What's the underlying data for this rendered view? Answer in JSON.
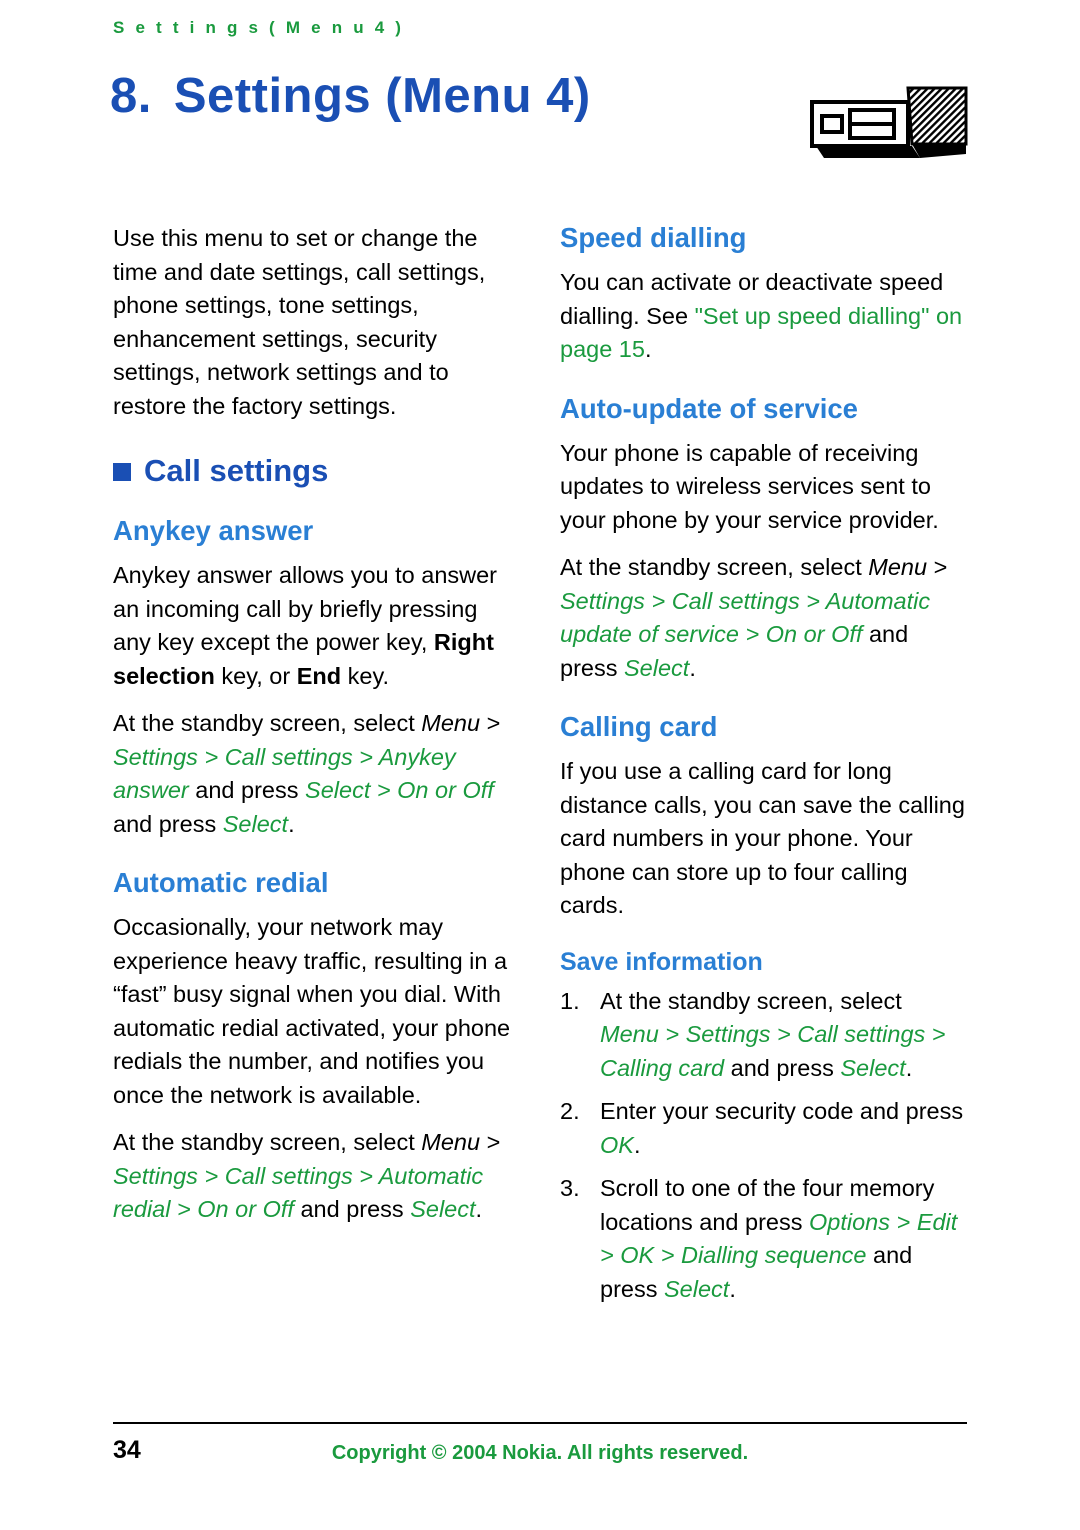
{
  "header": {
    "running_head": "S e t t i n g s   ( M e n u   4 )"
  },
  "title": {
    "number": "8.",
    "text": "Settings (Menu 4)",
    "icon": "screwdriver-tools-icon"
  },
  "left_column": {
    "intro": "Use this menu to set or change the time and date settings, call settings, phone settings, tone settings, enhancement settings, security settings, network settings and to restore the factory settings.",
    "call_settings_heading": "Call settings",
    "anykey_heading": "Anykey answer",
    "anykey_body_1": "Anykey answer allows you to answer an incoming call by briefly pressing any key except the power key, ",
    "anykey_body_bold_1": "Right selection",
    "anykey_body_2": " key, or ",
    "anykey_body_bold_2": "End",
    "anykey_body_3": " key.",
    "anykey_path_1": "At the standby screen, select ",
    "anykey_path_menu": "Menu",
    "anykey_path_2": " > ",
    "anykey_path_green": "Settings > Call settings > Anykey answer",
    "anykey_path_3": " and press ",
    "anykey_path_select1": "Select",
    "anykey_path_4": " > ",
    "anykey_path_on": "On",
    "anykey_path_5": " or ",
    "anykey_path_off": "Off",
    "anykey_path_6": " and press ",
    "anykey_path_select2": "Select",
    "anykey_path_7": ".",
    "autoredial_heading": "Automatic redial",
    "autoredial_body": "Occasionally, your network may experience heavy traffic, resulting in a “fast” busy signal when you dial. With automatic redial activated, your phone redials the number, and notifies you once the network is available.",
    "autoredial_path_1": "At the standby screen, select ",
    "autoredial_path_menu": "Menu",
    "autoredial_path_2": " > ",
    "autoredial_path_green": "Settings > Call settings > Automatic redial",
    "autoredial_path_3": " > ",
    "autoredial_path_on": "On",
    "autoredial_path_4": " or ",
    "autoredial_path_off": "Off",
    "autoredial_path_5": " and press ",
    "autoredial_path_select": "Select",
    "autoredial_path_6": "."
  },
  "right_column": {
    "speed_heading": "Speed dialling",
    "speed_body_1": "You can activate or deactivate speed dialling. See ",
    "speed_body_green1": "\"Set up speed dialling\" on page",
    "speed_body_2": " 15",
    "speed_body_3": ".",
    "autoupdate_heading": "Auto-update of service",
    "autoupdate_body": "Your phone is capable of receiving updates to wireless services sent to your phone by your service provider.",
    "autoupdate_path_1": "At the standby screen, select ",
    "autoupdate_path_menu": "Menu",
    "autoupdate_path_2": " > ",
    "autoupdate_path_green": "Settings > Call settings > Automatic update of service",
    "autoupdate_path_3": " > ",
    "autoupdate_path_on": "On",
    "autoupdate_path_4": " or ",
    "autoupdate_path_off": "Off",
    "autoupdate_path_5": " and press ",
    "autoupdate_path_select": "Select",
    "autoupdate_path_6": ".",
    "calling_card_heading": "Calling card",
    "calling_card_body": "If you use a calling card for long distance calls, you can save the calling card numbers in your phone. Your phone can store up to four calling cards.",
    "save_info_heading": "Save information",
    "steps": [
      {
        "n": "1.",
        "text_1": "At the standby screen, select ",
        "green_1": "Menu > Settings > Call settings > Calling card",
        "text_2": " and press ",
        "green_2": "Select",
        "text_3": "."
      },
      {
        "n": "2.",
        "text_1": "Enter your security code and press ",
        "green_1": "OK",
        "text_2": "."
      },
      {
        "n": "3.",
        "text_1": "Scroll to one of the four memory locations and press ",
        "green_1": "Options",
        "text_2": " > ",
        "green_2": "Edit > OK > Dialling sequence",
        "text_3": " and press ",
        "green_3": "Select",
        "text_4": "."
      }
    ]
  },
  "footer": {
    "page_number": "34",
    "copyright": "Copyright © 2004 Nokia. All rights reserved."
  },
  "colors": {
    "heading_blue": "#1a4fb4",
    "subheading_blue": "#2a7fd4",
    "green": "#1a9a3e"
  }
}
